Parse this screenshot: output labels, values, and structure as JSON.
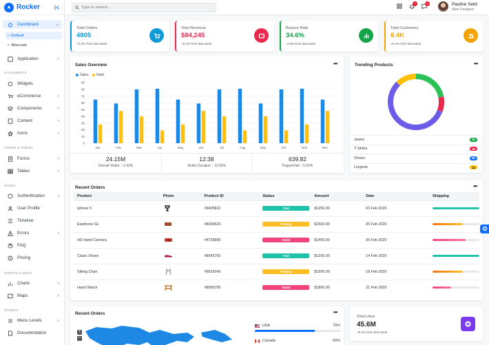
{
  "app": {
    "name": "Rocker"
  },
  "search": {
    "placeholder": "Type to search..."
  },
  "header": {
    "notifications_count": "7",
    "messages_count": "8"
  },
  "user": {
    "name": "Pauline Seitz",
    "role": "Web Designer"
  },
  "sidebar": {
    "dashboard": "Dashboard",
    "sub_default": "Default",
    "sub_alternate": "Alternate",
    "application": "Application",
    "section_ui": "UI Elements",
    "widgets": "Widgets",
    "ecommerce": "eCommerce",
    "components": "Components",
    "content": "Content",
    "icons": "Icons",
    "section_forms": "Forms & Tables",
    "forms": "Forms",
    "tables": "Tables",
    "section_pages": "Pages",
    "authentication": "Authentication",
    "user_profile": "User Profile",
    "timeline": "Timeline",
    "errors": "Errors",
    "faq": "FAQ",
    "pricing": "Pricing",
    "section_charts": "Charts & Maps",
    "charts": "Charts",
    "maps": "Maps",
    "section_others": "Others",
    "menu_levels": "Menu Levels",
    "documentation": "Documentation"
  },
  "stats": [
    {
      "title": "Total Orders",
      "value": "4805",
      "change": "+2.5% from last week",
      "color": "#0d9bd8",
      "icon": "cart-icon"
    },
    {
      "title": "Total Revenue",
      "value": "$84,245",
      "change": "+5.4% from last week",
      "color": "#e8294d",
      "icon": "wallet-icon"
    },
    {
      "title": "Bounce Rate",
      "value": "34.6%",
      "change": "-4.5% from last week",
      "color": "#15a34a",
      "icon": "bar-chart-icon"
    },
    {
      "title": "Total Customers",
      "value": "8.4K",
      "change": "+8.4% from last week",
      "color": "#f5a300",
      "icon": "users-icon"
    }
  ],
  "sales_overview": {
    "title": "Sales Overview",
    "summary": [
      {
        "value": "24.15M",
        "label": "Overall Visitor",
        "change": "↑ 2.43%"
      },
      {
        "value": "12:38",
        "label": "Visitor Duration",
        "change": "↑ 12.65%"
      },
      {
        "value": "639.82",
        "label": "Pages/Visit",
        "change": "↑ 5.62%"
      }
    ]
  },
  "chart_data": [
    {
      "type": "bar",
      "categories": [
        "Jan",
        "Feb",
        "Mar",
        "Apr",
        "May",
        "Jun",
        "Jul",
        "Aug",
        "Sep",
        "Oct",
        "Nov",
        "Dec"
      ],
      "series": [
        {
          "name": "Sales",
          "values": [
            65,
            59,
            80,
            81,
            65,
            59,
            80,
            81,
            59,
            80,
            81,
            65
          ],
          "color": "#1e88e5"
        },
        {
          "name": "Visits",
          "values": [
            28,
            48,
            40,
            19,
            28,
            48,
            40,
            19,
            40,
            19,
            28,
            48
          ],
          "color": "#ffc107"
        }
      ],
      "ylim": [
        0,
        90
      ],
      "yticks": [
        0,
        10,
        20,
        30,
        40,
        50,
        60,
        70,
        80,
        90
      ],
      "grid": true,
      "legend": "top-left"
    },
    {
      "type": "pie",
      "variant": "doughnut",
      "categories": [
        "Jeans",
        "T-Shirts",
        "Shoes",
        "Lingerie"
      ],
      "values": [
        25,
        10,
        65,
        14
      ],
      "colors": [
        "#2bc155",
        "#e8294d",
        "#6c5ce7",
        "#ffc107"
      ]
    }
  ],
  "trending": {
    "title": "Trending Products",
    "items": [
      {
        "name": "Jeans",
        "count": "25",
        "color": "#15a34a"
      },
      {
        "name": "T-Shirts",
        "count": "10",
        "color": "#e8294d"
      },
      {
        "name": "Shoes",
        "count": "65",
        "color": "#0d6efd"
      },
      {
        "name": "Lingerie",
        "count": "14",
        "color": "#ffc107"
      }
    ]
  },
  "orders": {
    "title": "Recent Orders",
    "columns": [
      "Product",
      "Photo",
      "Product ID",
      "Status",
      "Amount",
      "Date",
      "Shipping"
    ],
    "rows": [
      {
        "product": "Iphone 5",
        "photo": "phone-icon",
        "id": "#9405822",
        "status": "Paid",
        "status_color": "#1fc2a8",
        "amount": "$1250.00",
        "date": "03 Feb 2020",
        "shipping": 1.0,
        "ship_color": "#1fc2a8"
      },
      {
        "product": "Earphone GL",
        "photo": "earphone-icon",
        "id": "#8304620",
        "status": "Pending",
        "status_color": "#fbbf24",
        "amount": "$1500.00",
        "date": "05 Feb 2020",
        "shipping": 0.65,
        "ship_color": "#f97316"
      },
      {
        "product": "HD Hand Camera",
        "photo": "camera-icon",
        "id": "#4736890",
        "status": "Failed",
        "status_color": "#f0457a",
        "amount": "$1400.00",
        "date": "06 Feb 2020",
        "shipping": 0.7,
        "ship_color": "#f0457a"
      },
      {
        "product": "Clasic Shoes",
        "photo": "shoe-icon",
        "id": "#8543765",
        "status": "Paid",
        "status_color": "#1fc2a8",
        "amount": "$1200.00",
        "date": "14 Feb 2020",
        "shipping": 1.0,
        "ship_color": "#1fc2a8"
      },
      {
        "product": "Sitting Chair",
        "photo": "chair-icon",
        "id": "#9629240",
        "status": "Pending",
        "status_color": "#fbbf24",
        "amount": "$1500.00",
        "date": "18 Feb 2020",
        "shipping": 0.65,
        "ship_color": "#f97316"
      },
      {
        "product": "Hand Watch",
        "photo": "table-icon",
        "id": "#8506790",
        "status": "Failed",
        "status_color": "#f0457a",
        "amount": "$1800.00",
        "date": "21 Feb 2020",
        "shipping": 0.4,
        "ship_color": "#f0457a"
      }
    ]
  },
  "map_card": {
    "title": "Recent Orders",
    "zoom_in": "+",
    "zoom_out": "−",
    "countries": [
      {
        "name": "USA",
        "pct": "70%",
        "value": 0.7
      },
      {
        "name": "Canada",
        "pct": "65%",
        "value": 0.65
      }
    ]
  },
  "likes": {
    "title": "Total Likes",
    "value": "45.6M",
    "change": "+6.2% from last week"
  }
}
